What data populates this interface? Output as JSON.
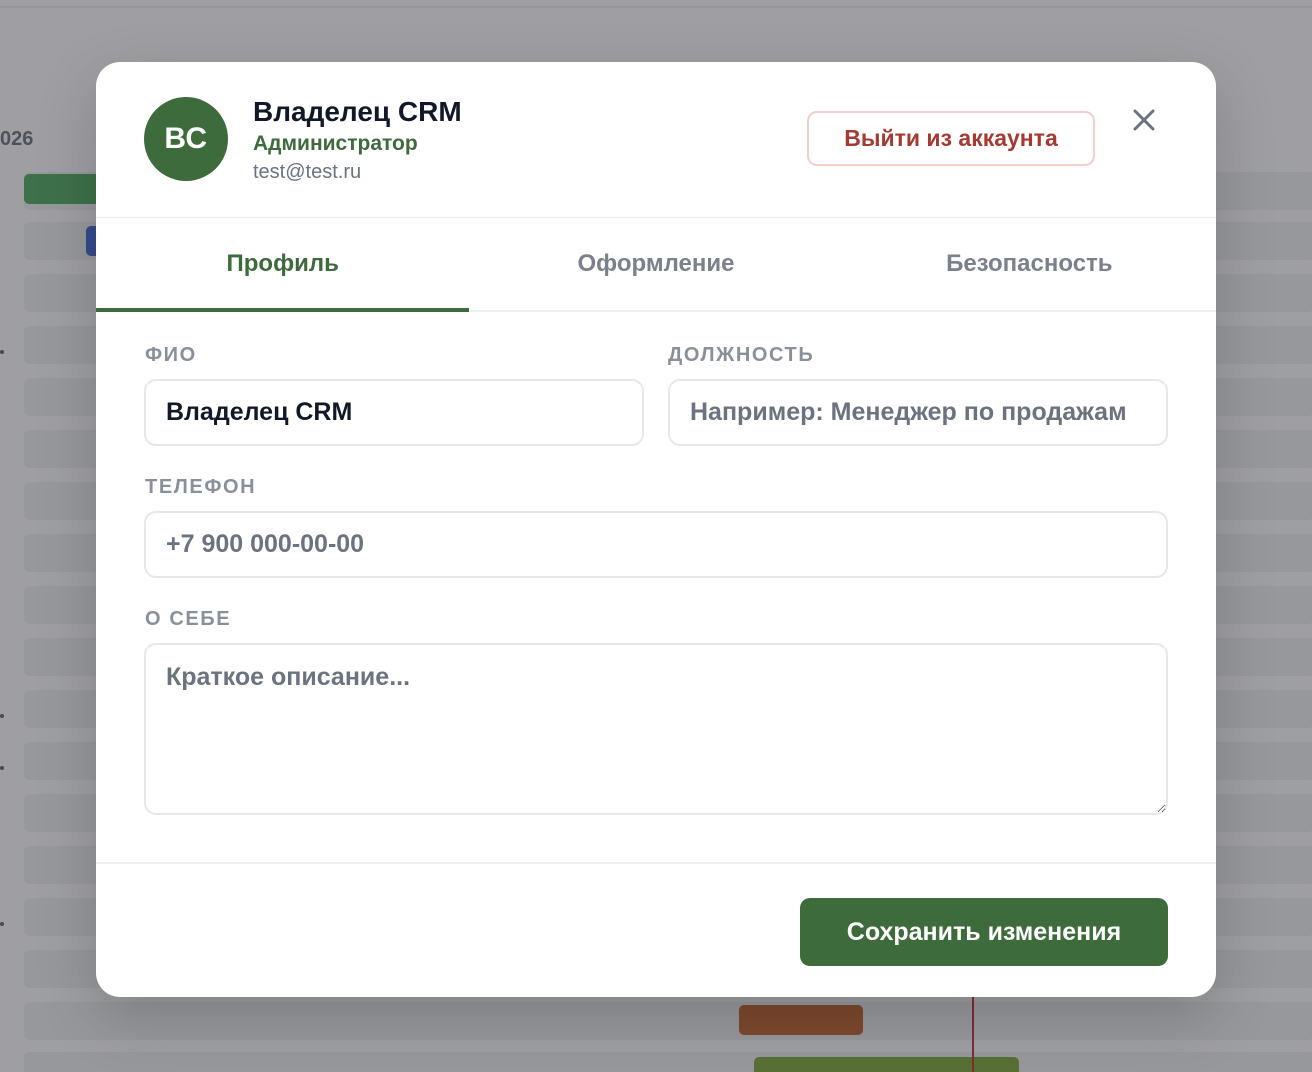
{
  "background": {
    "year_fragment": "026",
    "bar_colors": {
      "green": "#3f9e50",
      "blue": "#2d55c9",
      "orange": "#b3541e",
      "olive": "#6f9a2e"
    }
  },
  "modal": {
    "header": {
      "avatar_initials": "ВС",
      "user_name": "Владелец CRM",
      "user_role": "Администратор",
      "user_email": "test@test.ru",
      "logout_label": "Выйти из аккаунта",
      "close_icon": "close-icon"
    },
    "tabs": [
      {
        "label": "Профиль",
        "active": true
      },
      {
        "label": "Оформление",
        "active": false
      },
      {
        "label": "Безопасность",
        "active": false
      }
    ],
    "form": {
      "full_name": {
        "label": "ФИО",
        "value": "Владелец CRM",
        "placeholder": ""
      },
      "position": {
        "label": "ДОЛЖНОСТЬ",
        "value": "",
        "placeholder": "Например: Менеджер по продажам"
      },
      "phone": {
        "label": "ТЕЛЕФОН",
        "value": "",
        "placeholder": "+7 900 000-00-00"
      },
      "about": {
        "label": "О СЕБЕ",
        "value": "",
        "placeholder": "Краткое описание..."
      }
    },
    "footer": {
      "save_label": "Сохранить изменения"
    }
  },
  "colors": {
    "accent": "#3e6b3b",
    "danger": "#a63a32",
    "danger_border": "#f0cfcc",
    "muted_text": "#8a909a"
  }
}
